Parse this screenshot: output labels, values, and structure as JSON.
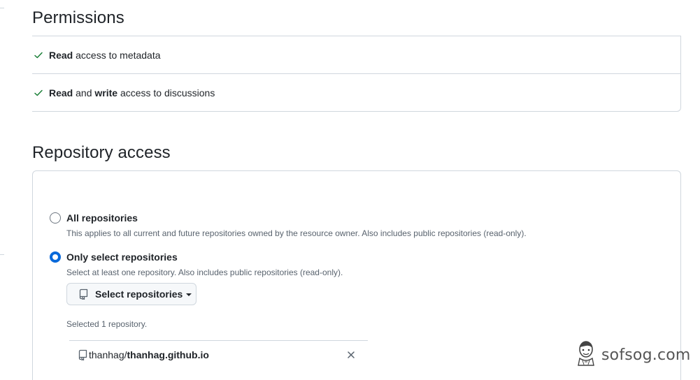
{
  "permissions": {
    "title": "Permissions",
    "items": [
      {
        "icon": "check-icon",
        "parts": [
          {
            "text": "Read",
            "bold": true
          },
          {
            "text": " access to metadata",
            "bold": false
          }
        ]
      },
      {
        "icon": "check-icon",
        "parts": [
          {
            "text": "Read",
            "bold": true
          },
          {
            "text": " and ",
            "bold": false
          },
          {
            "text": "write",
            "bold": true
          },
          {
            "text": " access to discussions",
            "bold": false
          }
        ]
      }
    ]
  },
  "repository_access": {
    "title": "Repository access",
    "options": [
      {
        "label": "All repositories",
        "description": "This applies to all current and future repositories owned by the resource owner. Also includes public repositories (read-only).",
        "checked": false
      },
      {
        "label": "Only select repositories",
        "description": "Select at least one repository. Also includes public repositories (read-only).",
        "checked": true
      }
    ],
    "select_button": {
      "label": "Select repositories",
      "icon": "repo-icon"
    },
    "selected_count": "Selected 1 repository.",
    "selected_repos": [
      {
        "owner": "thanhag",
        "separator": "/",
        "name": "thanhag.github.io",
        "remove_icon": "close-icon"
      }
    ]
  },
  "watermark": {
    "text": "sofsog.com"
  },
  "colors": {
    "accent": "#0969da",
    "check": "#1a7f37",
    "border": "#d0d7de",
    "muted": "#59636e"
  }
}
